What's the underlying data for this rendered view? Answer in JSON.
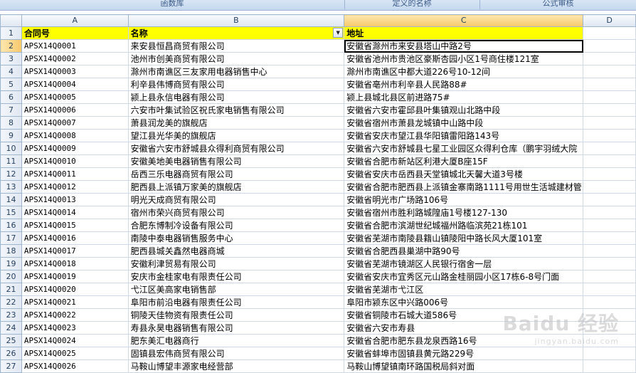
{
  "ribbon": {
    "groups": [
      "函数库",
      "定义的名称",
      "公式审核"
    ]
  },
  "columns": [
    "A",
    "B",
    "C",
    "D"
  ],
  "header_row": {
    "row_number": "1",
    "cells": [
      "合同号",
      "名称",
      "地址"
    ]
  },
  "rows": [
    {
      "n": "2",
      "a": "APSX14Q0001",
      "b": "来安县恒昌商贸有限公司",
      "c": "安徽省滁州市来安县塔山中路2号"
    },
    {
      "n": "3",
      "a": "APSX14Q0002",
      "b": "池州市创美商贸有限公司",
      "c": "安徽省池州市贵池区豪斯杏园小区1号商住楼121室"
    },
    {
      "n": "4",
      "a": "APSX14Q0003",
      "b": "滁州市南谯区三友家用电器销售中心",
      "c": "滁州市南谯区中都大道226号10-12间"
    },
    {
      "n": "5",
      "a": "APSX14Q0004",
      "b": "利辛县伟博商贸有限公司",
      "c": "安徽省亳州市利辛县人民路88#"
    },
    {
      "n": "6",
      "a": "APSX14Q0005",
      "b": "颍上县永信电器有限公司",
      "c": "颍上县城北县区前进路75#"
    },
    {
      "n": "7",
      "a": "APSX14Q0006",
      "b": "六安市叶集试验区祝氏家电销售有限公司",
      "c": "安徽省六安市霍邱县叶集镇观山北路中段"
    },
    {
      "n": "8",
      "a": "APSX14Q0007",
      "b": "萧县润龙美的旗舰店",
      "c": "安徽省宿州市萧县龙城镇中山路中段"
    },
    {
      "n": "9",
      "a": "APSX14Q0008",
      "b": "望江县光华美的旗舰店",
      "c": "安徽省安庆市望江县华阳镇雷阳路143号"
    },
    {
      "n": "10",
      "a": "APSX14Q0009",
      "b": "安徽省六安市舒城县众得利商贸有限公司",
      "c": "安徽省六安市舒城县七星工业园区众得利仓库（鹏宇羽绒大院"
    },
    {
      "n": "11",
      "a": "APSX14Q0010",
      "b": "安徽美地美电器销售有限公司",
      "c": "安徽省合肥市新站区利港大厦B座15F"
    },
    {
      "n": "12",
      "a": "APSX14Q0011",
      "b": "岳西三乐电器商贸有限公司",
      "c": "安徽省安庆市岳西县天堂镇城北天馨大道3号楼"
    },
    {
      "n": "13",
      "a": "APSX14Q0012",
      "b": "肥西县上派镇万家美的旗舰店",
      "c": "安徽省合肥市肥西县上派镇金寨南路1111号用世生活城建材管"
    },
    {
      "n": "14",
      "a": "APSX14Q0013",
      "b": "明光天成商贸有限公司",
      "c": "安徽省明光市广场路106号"
    },
    {
      "n": "15",
      "a": "APSX14Q0014",
      "b": "宿州市荣兴商贸有限公司",
      "c": "安徽省宿州市胜利路城隍庙1号楼127-130"
    },
    {
      "n": "16",
      "a": "APSX14Q0015",
      "b": "合肥东博制冷设备有限公司",
      "c": "安徽省合肥市滨湖世纪城福州路临滨苑21栋101"
    },
    {
      "n": "17",
      "a": "APSX14Q0016",
      "b": "南陵中泰电器销售服务中心",
      "c": "安徽省芜湖市南陵县籍山镇陵阳中路长风大厦101室"
    },
    {
      "n": "18",
      "a": "APSX14Q0017",
      "b": "肥西县城关鑫然电器商城",
      "c": "安徽省合肥西县巢湖中路90号"
    },
    {
      "n": "19",
      "a": "APSX14Q0018",
      "b": "安徽利津贸易有限公司",
      "c": "安徽省芜湖市镜湖区人民银行宿舍一层"
    },
    {
      "n": "20",
      "a": "APSX14Q0019",
      "b": "安庆市金桂家电有限责任公司",
      "c": "安徽省安庆市宜秀区元山路金桂丽园小区17栋6-8号门面"
    },
    {
      "n": "21",
      "a": "APSX14Q0020",
      "b": "弋江区美高家电销售部",
      "c": "安徽省芜湖市弋江区"
    },
    {
      "n": "22",
      "a": "APSX14Q0021",
      "b": "阜阳市前沿电器有限责任公司",
      "c": "阜阳市颍东区中兴路006号"
    },
    {
      "n": "23",
      "a": "APSX14Q0022",
      "b": "铜陵天佳物资有限责任公司",
      "c": "安徽省铜陵市石城大道586号"
    },
    {
      "n": "24",
      "a": "APSX14Q0023",
      "b": "寿县永昊电器销售有限公司",
      "c": "安徽省六安市寿县"
    },
    {
      "n": "25",
      "a": "APSX14Q0024",
      "b": "肥东美汇电器商行",
      "c": "安徽省合肥市肥东县龙泉西路16号"
    },
    {
      "n": "26",
      "a": "APSX14Q0025",
      "b": "固镇县宏伟商贸有限公司",
      "c": "安徽省蚌埠市固镇县黄元路229号"
    },
    {
      "n": "27",
      "a": "APSX14Q0026",
      "b": "马鞍山博望丰源家电经营部",
      "c": "马鞍山博望镇南环路国税局斜对面"
    }
  ],
  "watermark": {
    "text": "Baidu 经验",
    "sub": "jingyan.baidu.com"
  },
  "colors": {
    "header_fill": "#ffff00",
    "grid_line": "#d0d7e5",
    "selected_header": "#f7c86a"
  }
}
